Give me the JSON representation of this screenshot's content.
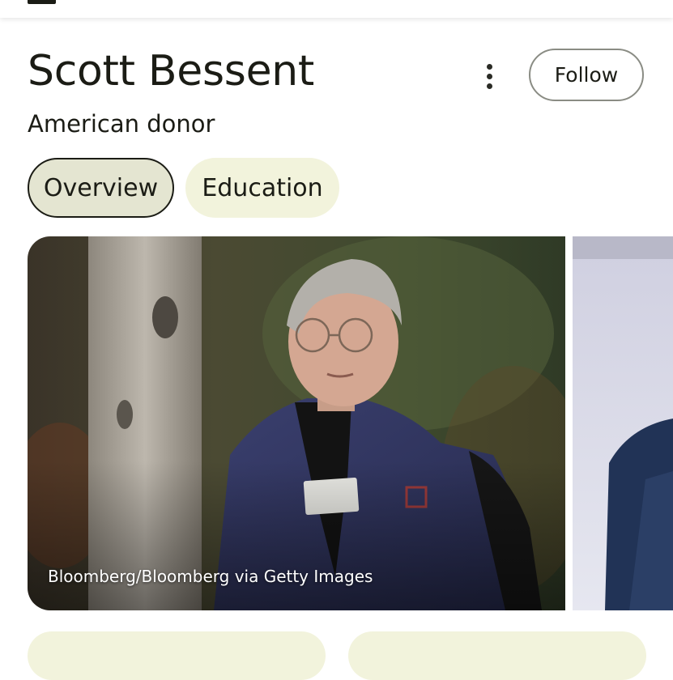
{
  "header": {
    "menu_icon": "hamburger-menu-icon"
  },
  "entity": {
    "name": "Scott Bessent",
    "description": "American donor",
    "more_icon": "more-vertical-icon",
    "follow_label": "Follow"
  },
  "tabs": [
    {
      "label": "Overview",
      "active": true
    },
    {
      "label": "Education",
      "active": false
    }
  ],
  "images": {
    "main_caption": "Bloomberg/Bloomberg via Getty Images"
  },
  "colors": {
    "active_tab_bg": "#e4e5d1",
    "inactive_tab_bg": "#f2f3dc",
    "text": "#1b1c15"
  }
}
